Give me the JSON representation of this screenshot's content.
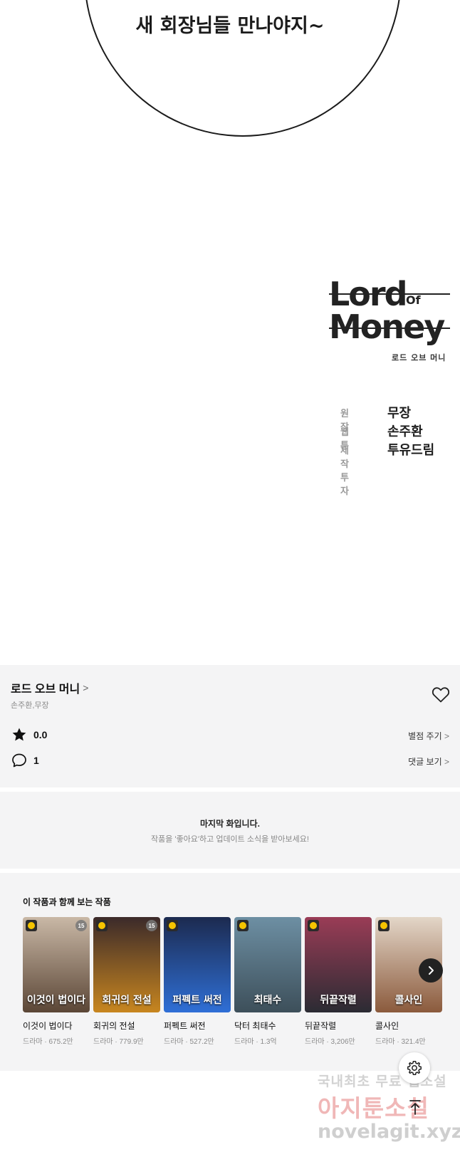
{
  "comic": {
    "bubble_line1": "",
    "bubble_line2": "새 회장님들 만나야지~",
    "logo": {
      "line1": "Lord",
      "of": "Of",
      "line2": "Money",
      "subtitle": "로드 오브 머니"
    },
    "credits": [
      {
        "label": "원작",
        "value": "무장"
      },
      {
        "label": "웹툰",
        "value": "손주환"
      },
      {
        "label": "제작투자",
        "value": "투유드림"
      }
    ]
  },
  "info": {
    "title": "로드 오브 머니",
    "chevron": ">",
    "authors": "손주환,무장",
    "rating": {
      "value": "0.0",
      "action": "별점 주기"
    },
    "comments": {
      "value": "1",
      "action": "댓글 보기"
    },
    "heart_icon": "heart-outline-icon"
  },
  "notice": {
    "title": "마지막 화입니다.",
    "subtitle": "작품을 '좋아요'하고 업데이트 소식을 받아보세요!"
  },
  "recommendations": {
    "title": "이 작품과 함께 보는 작품",
    "items": [
      {
        "name": "이것이 법이다",
        "meta": "드라마 · 675.2만",
        "badge": "15",
        "art_text": "이것이 법이다",
        "color_top": "#c9b8a6",
        "color_bottom": "#5b4636"
      },
      {
        "name": "회귀의 전설",
        "meta": "드라마 · 779.9만",
        "badge": "15",
        "art_text": "회귀의 전설",
        "color_top": "#3b2a2a",
        "color_bottom": "#c8861f"
      },
      {
        "name": "퍼펙트 써전",
        "meta": "드라마 · 527.2만",
        "badge": "",
        "art_text": "퍼펙트 써전",
        "color_top": "#1c2a4f",
        "color_bottom": "#2f6fd6"
      },
      {
        "name": "닥터 최태수",
        "meta": "드라마 · 1.3억",
        "badge": "",
        "art_text": "최태수",
        "color_top": "#6d8fa3",
        "color_bottom": "#3d4f5a"
      },
      {
        "name": "뒤끝작렬",
        "meta": "드라마 · 3,206만",
        "badge": "",
        "art_text": "뒤끝작렬",
        "color_top": "#9a3c56",
        "color_bottom": "#2b2b33"
      },
      {
        "name": "콜사인",
        "meta": "드라마 · 321.4만",
        "badge": "",
        "art_text": "콜사인",
        "color_top": "#e3d6c8",
        "color_bottom": "#8b5a3c"
      }
    ]
  },
  "controls": {
    "settings_icon": "gear-icon",
    "scroll_top_icon": "arrow-up-icon",
    "next_icon": "chevron-right-icon"
  },
  "watermark": {
    "line1": "국내최초 무료 웹소설",
    "line2": "아지툰소설",
    "line3": "novelagit.xyz"
  }
}
